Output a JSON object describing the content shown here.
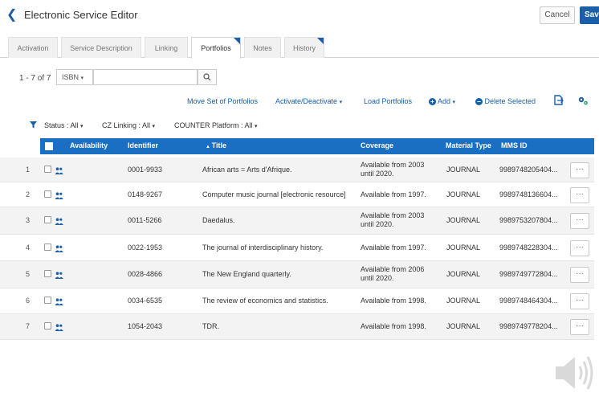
{
  "header": {
    "title": "Electronic Service Editor",
    "cancel_label": "Cancel",
    "save_label": "Save"
  },
  "tabs": [
    {
      "label": "Activation",
      "active": false
    },
    {
      "label": "Service Description",
      "active": false
    },
    {
      "label": "Linking",
      "active": false
    },
    {
      "label": "Portfolios",
      "active": true
    },
    {
      "label": "Notes",
      "active": false
    },
    {
      "label": "History",
      "active": false
    }
  ],
  "search": {
    "count_text": "1 - 7 of 7",
    "field_select": "ISBN",
    "query": ""
  },
  "actions": {
    "move_set": "Move Set of Portfolios",
    "activate": "Activate/Deactivate",
    "load": "Load Portfolios",
    "add": "Add",
    "delete_selected": "Delete Selected"
  },
  "filters": {
    "status": "Status : All",
    "cz_linking": "CZ Linking : All",
    "counter": "COUNTER Platform : All"
  },
  "table": {
    "columns": {
      "availability": "Availability",
      "identifier": "Identifier",
      "title": "Title",
      "coverage": "Coverage",
      "material_type": "Material Type",
      "mms_id": "MMS ID"
    },
    "rows": [
      {
        "num": "1",
        "identifier": "0001-9933",
        "title": "African arts = Arts d'Afrique.",
        "coverage": "Available from 2003 until 2020.",
        "material": "JOURNAL",
        "mms": "9989748205404..."
      },
      {
        "num": "2",
        "identifier": "0148-9267",
        "title": "Computer music journal [electronic resource]",
        "coverage": "Available from 1997.",
        "material": "JOURNAL",
        "mms": "9989748136604..."
      },
      {
        "num": "3",
        "identifier": "0011-5266",
        "title": "Daedalus.",
        "coverage": "Available from 2003 until 2020.",
        "material": "JOURNAL",
        "mms": "9989753207804..."
      },
      {
        "num": "4",
        "identifier": "0022-1953",
        "title": "The journal of interdisciplinary history.",
        "coverage": "Available from 1997.",
        "material": "JOURNAL",
        "mms": "9989748228304..."
      },
      {
        "num": "5",
        "identifier": "0028-4866",
        "title": "The New England quarterly.",
        "coverage": "Available from 2006 until 2020.",
        "material": "JOURNAL",
        "mms": "9989749772804..."
      },
      {
        "num": "6",
        "identifier": "0034-6535",
        "title": "The review of economics and statistics.",
        "coverage": "Available from 1998.",
        "material": "JOURNAL",
        "mms": "9989748464304..."
      },
      {
        "num": "7",
        "identifier": "1054-2043",
        "title": "TDR.",
        "coverage": "Available from 1998.",
        "material": "JOURNAL",
        "mms": "9989749778204..."
      }
    ],
    "more_label": "···"
  },
  "colors": {
    "accent": "#1a5fa8",
    "header_bg": "#1a6fc2"
  }
}
